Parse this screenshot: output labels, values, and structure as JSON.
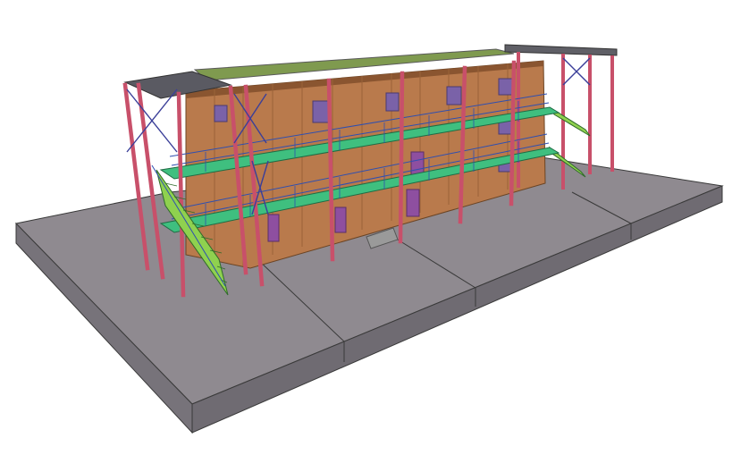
{
  "scene": {
    "subject": "3d-structural-model-three-storey-building",
    "colors": {
      "background": "#ffffff",
      "slab_top": "#8f8a90",
      "slab_side": "#77737a",
      "slab_edge": "#3a3a3a",
      "wall": "#b97a4c",
      "wall_shade": "#a86b3e",
      "roof": "#7f9a4f",
      "roof_edge": "#5a5a5a",
      "column": "#c8506a",
      "column_dark": "#8c2f45",
      "balcony_deck": "#3fbf7f",
      "railing": "#2f4fb0",
      "stair": "#8fd14f",
      "window": "#7a62a8",
      "door": "#8e4fa0",
      "bracing": "#3b3f99"
    },
    "icons": [
      "building-model",
      "foundation-slab",
      "external-staircase"
    ]
  }
}
